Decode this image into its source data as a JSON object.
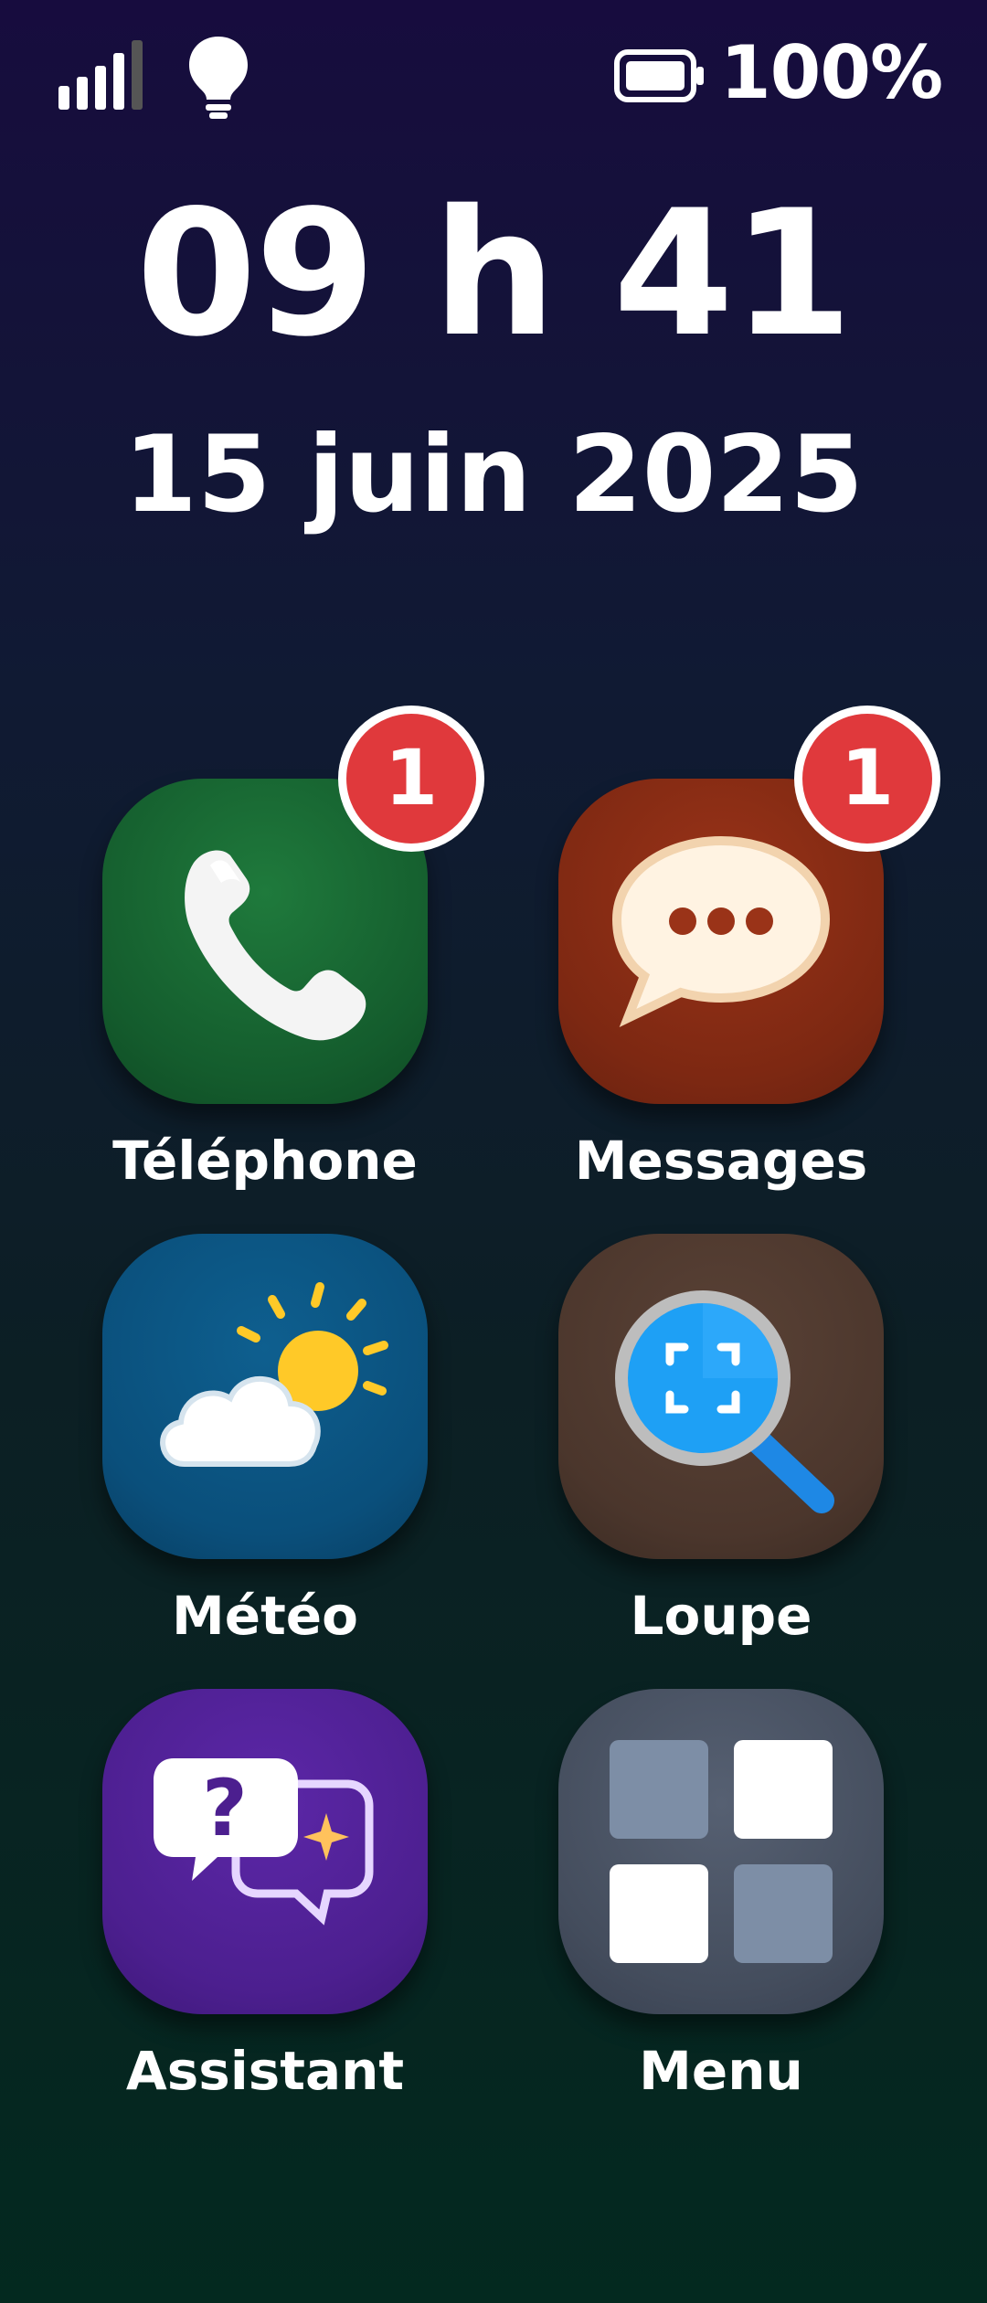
{
  "status_bar": {
    "battery_percent": "100%",
    "signal_bars_filled": 4,
    "signal_bars_total": 5
  },
  "clock": {
    "time": "09 h 41",
    "date": "15 juin 2025"
  },
  "apps": [
    {
      "label": "Téléphone",
      "badge": "1",
      "icon": "phone-icon",
      "color": "#145c2d"
    },
    {
      "label": "Messages",
      "badge": "1",
      "icon": "chat-bubble-icon",
      "color": "#7d2812"
    },
    {
      "label": "Météo",
      "icon": "weather-icon",
      "color": "#0a4f7b"
    },
    {
      "label": "Loupe",
      "icon": "magnifier-icon",
      "color": "#4b362c"
    },
    {
      "label": "Assistant",
      "icon": "assistant-icon",
      "color": "#4c1f8f"
    },
    {
      "label": "Menu",
      "icon": "grid-icon",
      "color": "#444d5d"
    }
  ],
  "colors": {
    "badge": "#e0393c",
    "background_top": "#170c3e",
    "background_bottom": "#03291f"
  }
}
